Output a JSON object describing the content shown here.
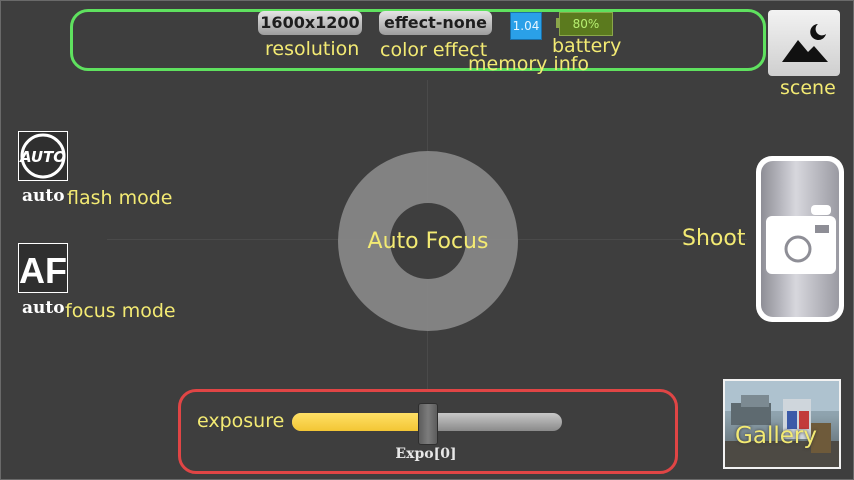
{
  "top_bar": {
    "resolution": {
      "value": "1600x1200",
      "label": "resolution"
    },
    "color_effect": {
      "value": "effect-none",
      "label": "color effect"
    },
    "memory": {
      "value": "1.04",
      "label": "memory info"
    },
    "battery": {
      "value": "80%",
      "label": "battery"
    }
  },
  "scene": {
    "label": "scene"
  },
  "flash": {
    "value": "auto",
    "label": "flash mode"
  },
  "focus_mode": {
    "value": "auto",
    "label": "focus mode"
  },
  "focus": {
    "label": "Auto Focus"
  },
  "shoot": {
    "label": "Shoot"
  },
  "exposure": {
    "label": "exposure",
    "value_text": "Expo[0]",
    "level": 0.5
  },
  "gallery": {
    "label": "Gallery"
  },
  "colors": {
    "label_yellow": "#f3ea73",
    "top_panel_border": "#5fe15f",
    "exposure_panel_border": "#e04545",
    "slider_fill": "#f3c634",
    "memory_box": "#2aa0e8",
    "battery_box": "#5b7a1e"
  },
  "icons": {
    "flash": "flash-auto-icon",
    "focus": "autofocus-af-icon",
    "scene": "landscape-moon-icon",
    "shoot": "camera-icon"
  }
}
